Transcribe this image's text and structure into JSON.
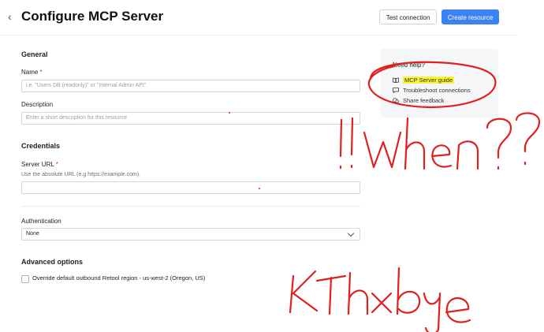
{
  "header": {
    "back_icon": "chevron-left-icon",
    "title": "Configure MCP Server",
    "test_connection_label": "Test connection",
    "create_resource_label": "Create resource"
  },
  "general": {
    "section_title": "General",
    "name_label": "Name",
    "name_required": "*",
    "name_placeholder": "i.e. \"Users DB (readonly)\" or \"Internal Admin API\"",
    "description_label": "Description",
    "description_placeholder": "Enter a short description for this resource"
  },
  "credentials": {
    "section_title": "Credentials",
    "server_url_label": "Server URL",
    "server_url_required": "*",
    "server_url_hint": "Use the absolute URL (e.g https://example.com).",
    "server_url_value": ""
  },
  "authentication": {
    "label": "Authentication",
    "selected": "None"
  },
  "advanced": {
    "section_title": "Advanced options",
    "override_region_label": "Override default outbound Retool region - us-west-2 (Oregon, US)",
    "override_region_checked": false
  },
  "help": {
    "title": "Need help?",
    "items": [
      {
        "label": "MCP Server guide",
        "icon": "book-icon"
      },
      {
        "label": "Troubleshoot connections",
        "icon": "chat-icon"
      },
      {
        "label": "Share feedback",
        "icon": "feedback-icon"
      }
    ]
  },
  "annotations": {
    "color": "#e02020",
    "highlight_color": "#f7f53a"
  }
}
